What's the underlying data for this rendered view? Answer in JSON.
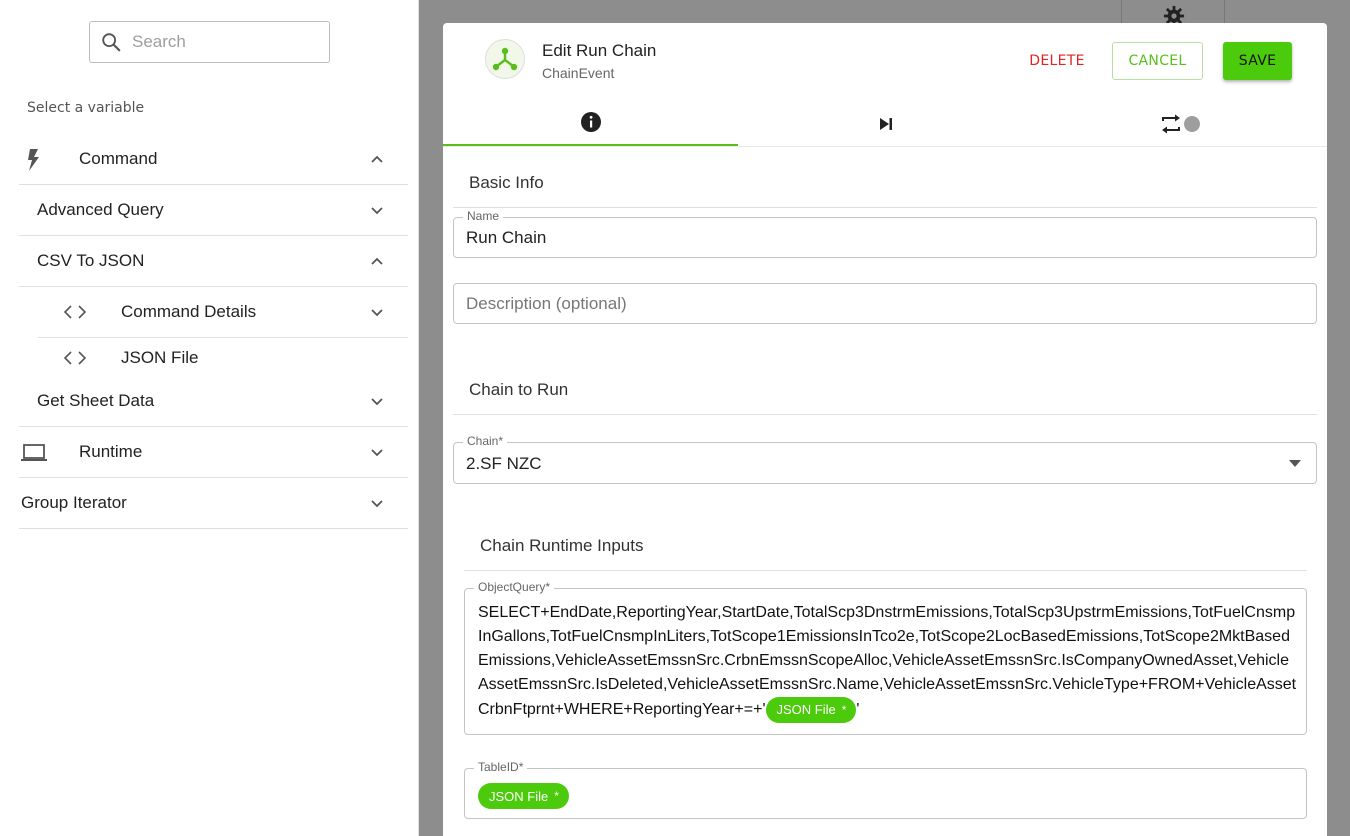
{
  "sidebar": {
    "search_placeholder": "Search",
    "select_label": "Select a variable",
    "items": [
      {
        "label": "Command",
        "icon": "bolt-icon",
        "expanded": true
      },
      {
        "label": "Advanced Query",
        "expanded": false
      },
      {
        "label": "CSV To JSON",
        "expanded": true
      },
      {
        "label": "Command Details",
        "icon": "code-icon",
        "expanded": false
      },
      {
        "label": "JSON File",
        "icon": "code-icon"
      },
      {
        "label": "Get Sheet Data",
        "expanded": false
      },
      {
        "label": "Runtime",
        "icon": "laptop-icon",
        "expanded": false
      },
      {
        "label": "Group Iterator",
        "expanded": false
      }
    ]
  },
  "dialog": {
    "title": "Edit Run Chain",
    "subtitle": "ChainEvent",
    "delete_label": "DELETE",
    "cancel_label": "CANCEL",
    "save_label": "SAVE",
    "tabs": [
      {
        "icon": "info-icon",
        "active": true
      },
      {
        "icon": "skip-next-icon",
        "active": false
      },
      {
        "icon": "repeat-icon",
        "active": false
      }
    ]
  },
  "basic_info": {
    "section_title": "Basic Info",
    "name_label": "Name",
    "name_value": "Run Chain",
    "description_placeholder": "Description (optional)"
  },
  "chain_to_run": {
    "section_title": "Chain to Run",
    "chain_label": "Chain*",
    "chain_value": "2.SF NZC"
  },
  "runtime_inputs": {
    "section_title": "Chain Runtime Inputs",
    "object_query_label": "ObjectQuery*",
    "object_query_text": "SELECT+EndDate,ReportingYear,StartDate,TotalScp3DnstrmEmissions,TotalScp3UpstrmEmissions,TotFuelCnsmpInGallons,TotFuelCnsmpInLiters,TotScope1EmissionsInTco2e,TotScope2LocBasedEmissions,TotScope2MktBasedEmissions,VehicleAssetEmssnSrc.CrbnEmssnScopeAlloc,VehicleAssetEmssnSrc.IsCompanyOwnedAsset,VehicleAssetEmssnSrc.IsDeleted,VehicleAssetEmssnSrc.Name,VehicleAssetEmssnSrc.VehicleType+FROM+VehicleAssetCrbnFtprnt+WHERE+ReportingYear+=+'",
    "object_query_chip": "JSON File",
    "object_query_suffix": "'",
    "table_id_label": "TableID*",
    "table_id_chip": "JSON File",
    "chip_star": "*"
  },
  "colors": {
    "accent": "#4ccb0d",
    "delete": "#e02424",
    "backdrop": "#8d8d8d"
  }
}
